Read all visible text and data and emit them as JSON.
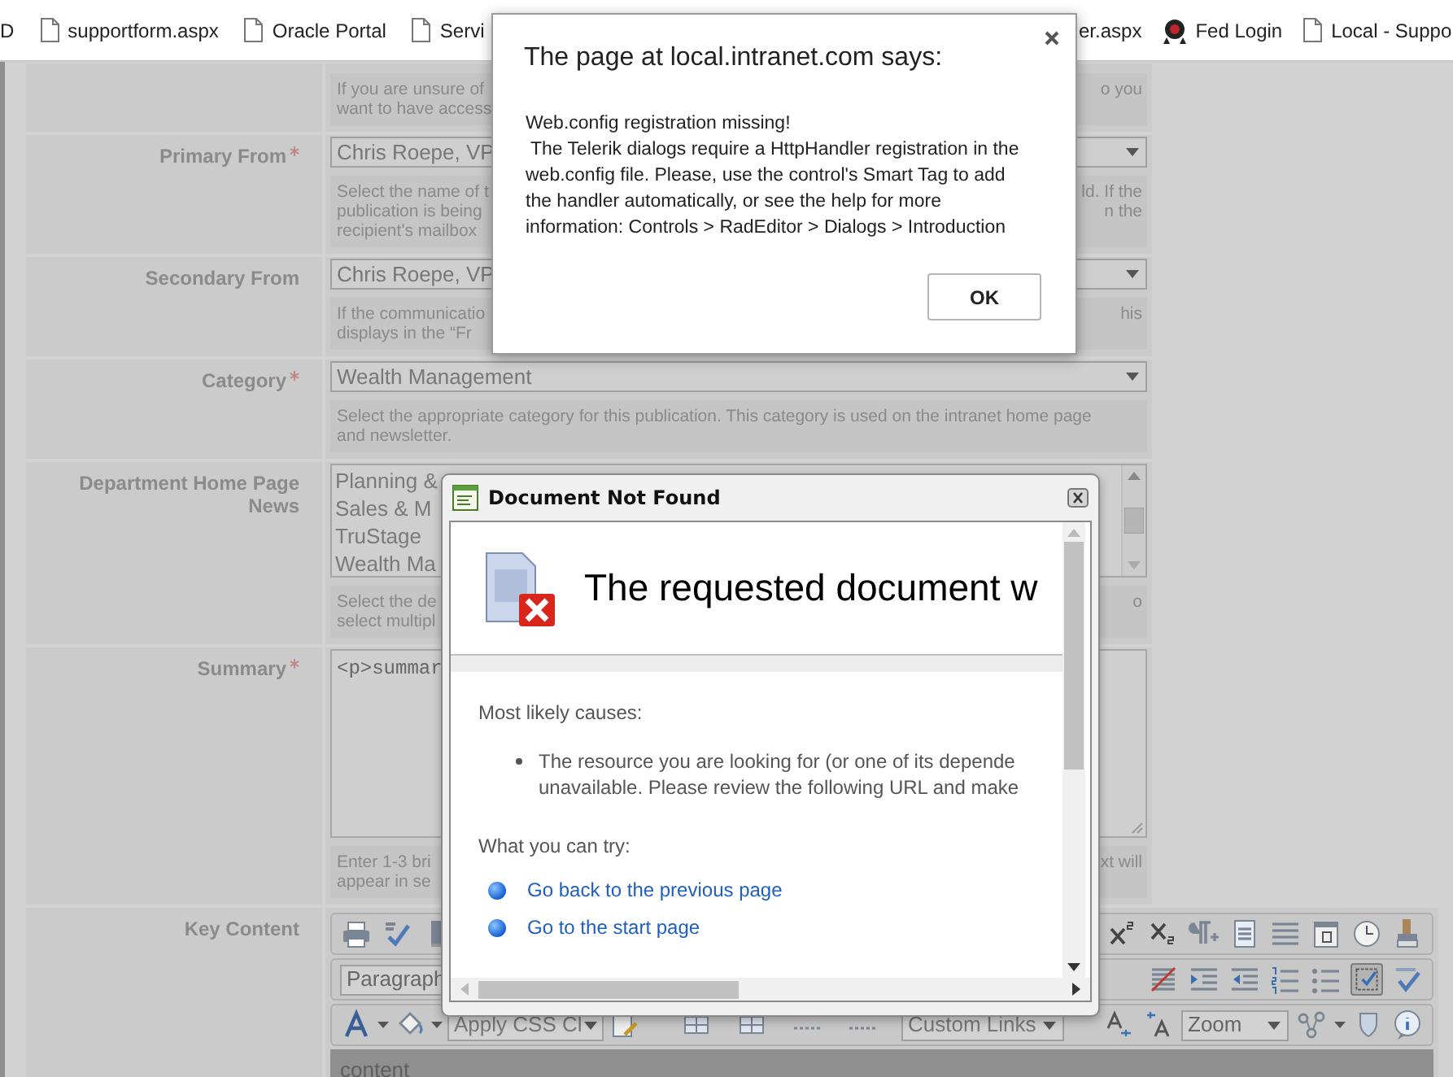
{
  "bookmarks": {
    "left": [
      {
        "kind": "text",
        "label": "D"
      },
      {
        "kind": "page",
        "label": "supportform.aspx"
      },
      {
        "kind": "page",
        "label": "Oracle Portal"
      },
      {
        "kind": "page",
        "label": "Servi"
      }
    ],
    "right": [
      {
        "kind": "text",
        "label": "er.aspx"
      },
      {
        "kind": "logo",
        "label": "Fed Login"
      },
      {
        "kind": "page",
        "label": "Local - Suppo"
      }
    ]
  },
  "form": {
    "rows": [
      {
        "required": false,
        "field": {
          "kind": "none"
        },
        "help": {
          "left": [
            "If you are unsure of",
            "want to have access"
          ],
          "right": [
            "o you"
          ]
        }
      },
      {
        "label": "Primary From",
        "required": true,
        "field": {
          "kind": "select",
          "value": "Chris Roepe, VP"
        },
        "help": {
          "left": [
            "Select the name of t",
            "publication is being",
            "recipient's mailbox"
          ],
          "right": [
            "ld. If the",
            "n the"
          ]
        }
      },
      {
        "label": "Secondary From",
        "required": false,
        "field": {
          "kind": "select",
          "value": "Chris Roepe, VP"
        },
        "help": {
          "left": [
            "If the communicatio",
            "displays in the “Fr"
          ],
          "right": [
            "his"
          ]
        }
      },
      {
        "label": "Category",
        "required": true,
        "field": {
          "kind": "select",
          "value": "Wealth Management"
        },
        "help": {
          "left": [
            "Select the appropriate category for this publication. This category is used on the intranet home page",
            "and newsletter."
          ]
        }
      },
      {
        "label": "Department Home Page News",
        "required": false,
        "field": {
          "kind": "listbox",
          "options": [
            {
              "label": "Planning &",
              "selected": false
            },
            {
              "label": "Sales & M",
              "selected": false
            },
            {
              "label": "TruStage",
              "selected": false
            },
            {
              "label": "Wealth Ma",
              "selected": false
            }
          ]
        },
        "help": {
          "left": [
            "Select the de",
            "select multipl"
          ],
          "right": [
            "o"
          ]
        }
      },
      {
        "label": "Summary",
        "required": true,
        "field": {
          "kind": "textarea",
          "value": "<p>summar"
        },
        "help": {
          "left": [
            "Enter 1-3 bri",
            "appear in se"
          ],
          "right": [
            "xt will"
          ]
        }
      },
      {
        "label": "Key Content",
        "required": false,
        "field": {
          "kind": "editor",
          "format_select": "Paragraph",
          "css_select": "Apply CSS Cl",
          "links_select": "Custom Links",
          "zoom_select": "Zoom",
          "toggle_pressed": true,
          "content": "content"
        }
      }
    ]
  },
  "alert": {
    "title": "The page at local.intranet.com says:",
    "message": "Web.config registration missing!\n The Telerik dialogs require a HttpHandler registration in the\nweb.config file. Please, use the control's Smart Tag to add\nthe handler automatically, or see the help for more\ninformation: Controls > RadEditor > Dialogs > Introduction",
    "button": "OK"
  },
  "dialog": {
    "title": "Document Not Found",
    "heading": "The requested document w",
    "causes_title": "Most likely causes:",
    "causes": [
      "The resource you are looking for (or one of its depende\nunavailable. Please review the following URL and make"
    ],
    "try_title": "What you can try:",
    "links": [
      "Go back to the previous page",
      "Go to the start page"
    ]
  }
}
